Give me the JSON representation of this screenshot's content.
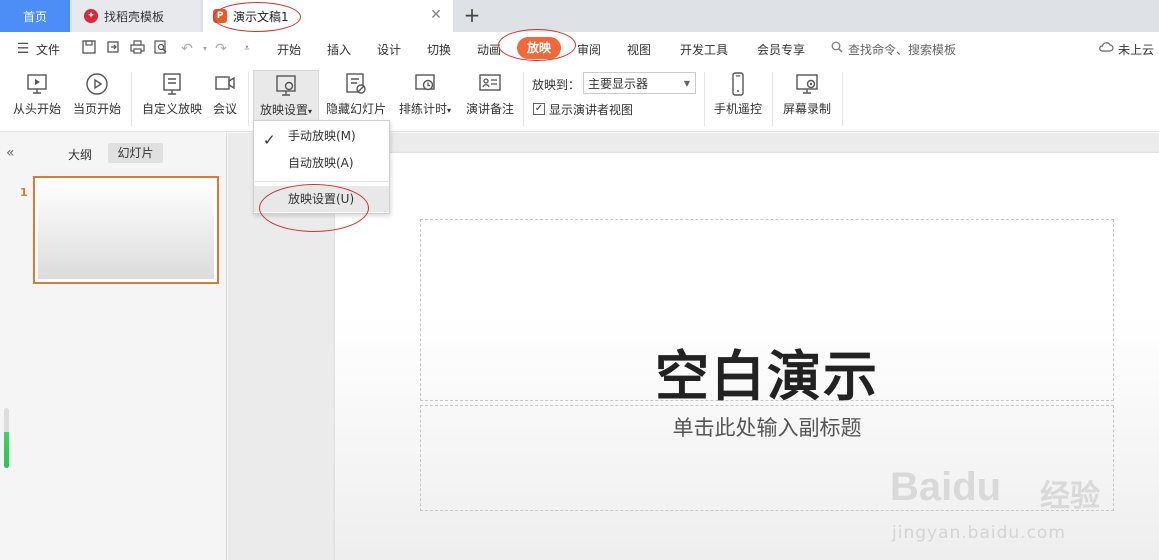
{
  "tabs": {
    "home": "首页",
    "template": "找稻壳模板",
    "document": "演示文稿1"
  },
  "menu": {
    "file": "文件",
    "items": [
      "开始",
      "插入",
      "设计",
      "切换",
      "动画",
      "放映",
      "审阅",
      "视图",
      "开发工具",
      "会员专享"
    ],
    "active": "放映",
    "search": "查找命令、搜索模板",
    "cloud": "未上云"
  },
  "ribbon": {
    "from_start": "从头开始",
    "from_current": "当页开始",
    "custom_show": "自定义放映",
    "meeting": "会议",
    "show_setup": "放映设置",
    "hide_slide": "隐藏幻灯片",
    "rehearse": "排练计时",
    "speaker_notes": "演讲备注",
    "play_to_label": "放映到：",
    "play_to_value": "主要显示器",
    "presenter_view": "显示演讲者视图",
    "phone_remote": "手机遥控",
    "screen_record": "屏幕录制"
  },
  "dropdown": {
    "manual": "手动放映(M)",
    "auto": "自动放映(A)",
    "setup": "放映设置(U)"
  },
  "leftpanel": {
    "outline": "大纲",
    "slides": "幻灯片",
    "slide_number": "1"
  },
  "slide": {
    "title": "空白演示",
    "subtitle": "单击此处输入副标题"
  },
  "watermark": {
    "logo": "Baidu",
    "cn": "经验",
    "url": "jingyan.baidu.com"
  },
  "colors": {
    "accent": "#ee6a3a",
    "home_tab": "#4c8df6",
    "annotation": "#d23030"
  }
}
